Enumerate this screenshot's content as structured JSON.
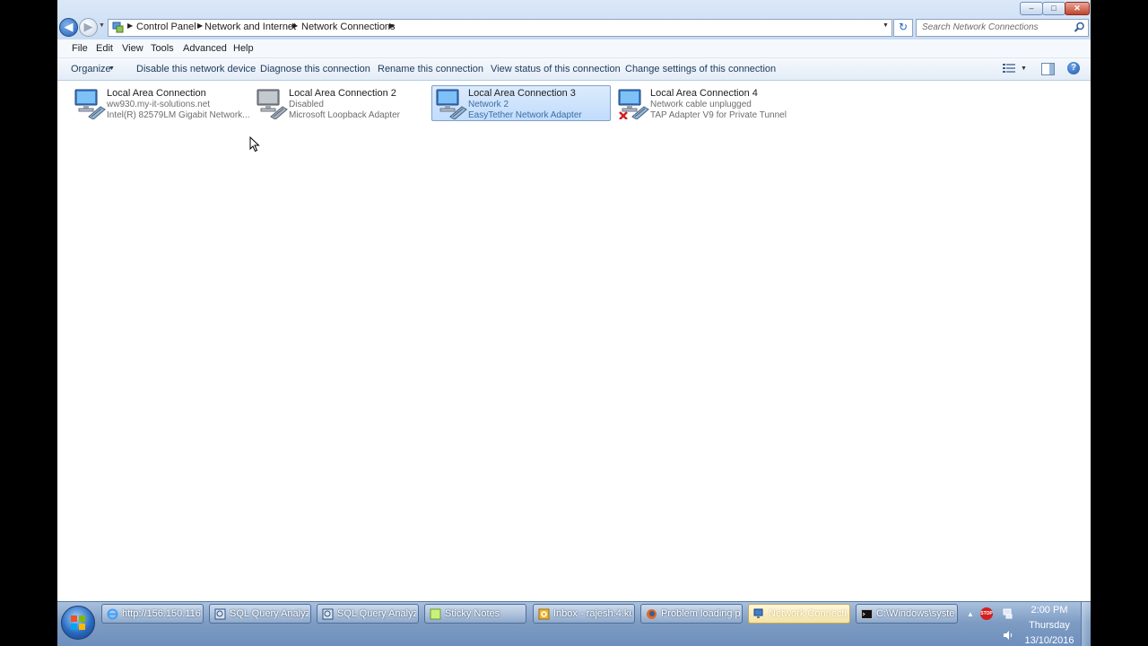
{
  "window": {
    "minimize": "–",
    "maximize": "□",
    "close": "✕"
  },
  "nav": {
    "back_glyph": "◀",
    "forward_glyph": "▶"
  },
  "breadcrumb": [
    "Control Panel",
    "Network and Internet",
    "Network Connections"
  ],
  "search": {
    "placeholder": "Search Network Connections"
  },
  "menu": [
    "File",
    "Edit",
    "View",
    "Tools",
    "Advanced",
    "Help"
  ],
  "commands": {
    "organize": "Organize",
    "disable": "Disable this network device",
    "diagnose": "Diagnose this connection",
    "rename": "Rename this connection",
    "view_status": "View status of this connection",
    "change_settings": "Change settings of this connection"
  },
  "help_glyph": "?",
  "connections": [
    {
      "name": "Local Area Connection",
      "status": "ww930.my-it-solutions.net",
      "device": "Intel(R) 82579LM Gigabit Network...",
      "state": "connected",
      "selected": false
    },
    {
      "name": "Local Area Connection 2",
      "status": "Disabled",
      "device": "Microsoft Loopback Adapter",
      "state": "disabled",
      "selected": false
    },
    {
      "name": "Local Area Connection 3",
      "status": "Network  2",
      "device": "EasyTether Network Adapter",
      "state": "connected",
      "selected": true
    },
    {
      "name": "Local Area Connection 4",
      "status": "Network cable unplugged",
      "device": "TAP Adapter V9 for Private Tunnel",
      "state": "unplugged",
      "selected": false
    }
  ],
  "taskbar": {
    "items": [
      {
        "label": "http://156.150.116....",
        "icon": "ie-icon",
        "active": false
      },
      {
        "label": "SQL Query Analyze...",
        "icon": "sql-query-analyzer-icon",
        "active": false
      },
      {
        "label": "SQL Query Analyze...",
        "icon": "sql-query-analyzer-icon",
        "active": false
      },
      {
        "label": "Sticky Notes",
        "icon": "sticky-notes-icon",
        "active": false
      },
      {
        "label": "Inbox - rajesh.4.ku...",
        "icon": "outlook-icon",
        "active": false
      },
      {
        "label": "Problem loading p...",
        "icon": "firefox-icon",
        "active": false
      },
      {
        "label": "Network Connecti...",
        "icon": "network-connections-icon",
        "active": true
      },
      {
        "label": "C:\\Windows\\syste...",
        "icon": "cmd-icon",
        "active": false
      }
    ],
    "tray_stop_label": "STOP",
    "clock": {
      "time": "2:00 PM",
      "day": "Thursday",
      "date": "13/10/2016"
    }
  },
  "colors": {
    "accent": "#1f5fb8",
    "selection": "#c1dcfc",
    "taskbar": "#7e9cc3",
    "error_red": "#d32020"
  }
}
